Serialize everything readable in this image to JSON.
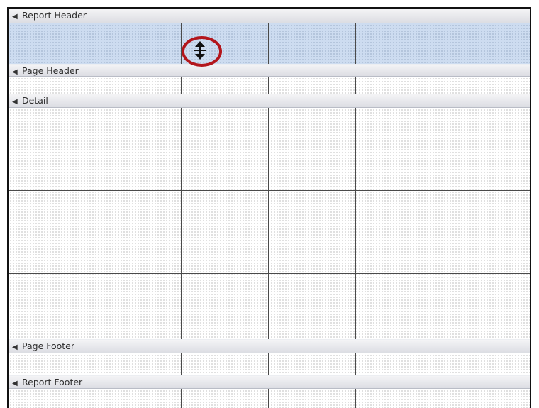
{
  "sections": {
    "report_header": "Report Header",
    "page_header": "Page Header",
    "detail": "Detail",
    "page_footer": "Page Footer",
    "report_footer": "Report Footer"
  },
  "icons": {
    "section_grip": "section-expand-icon",
    "cursor": "resize-vertical-cursor-icon"
  },
  "colors": {
    "selected_section": "#cddcf0",
    "highlight_circle": "#b3161c"
  }
}
